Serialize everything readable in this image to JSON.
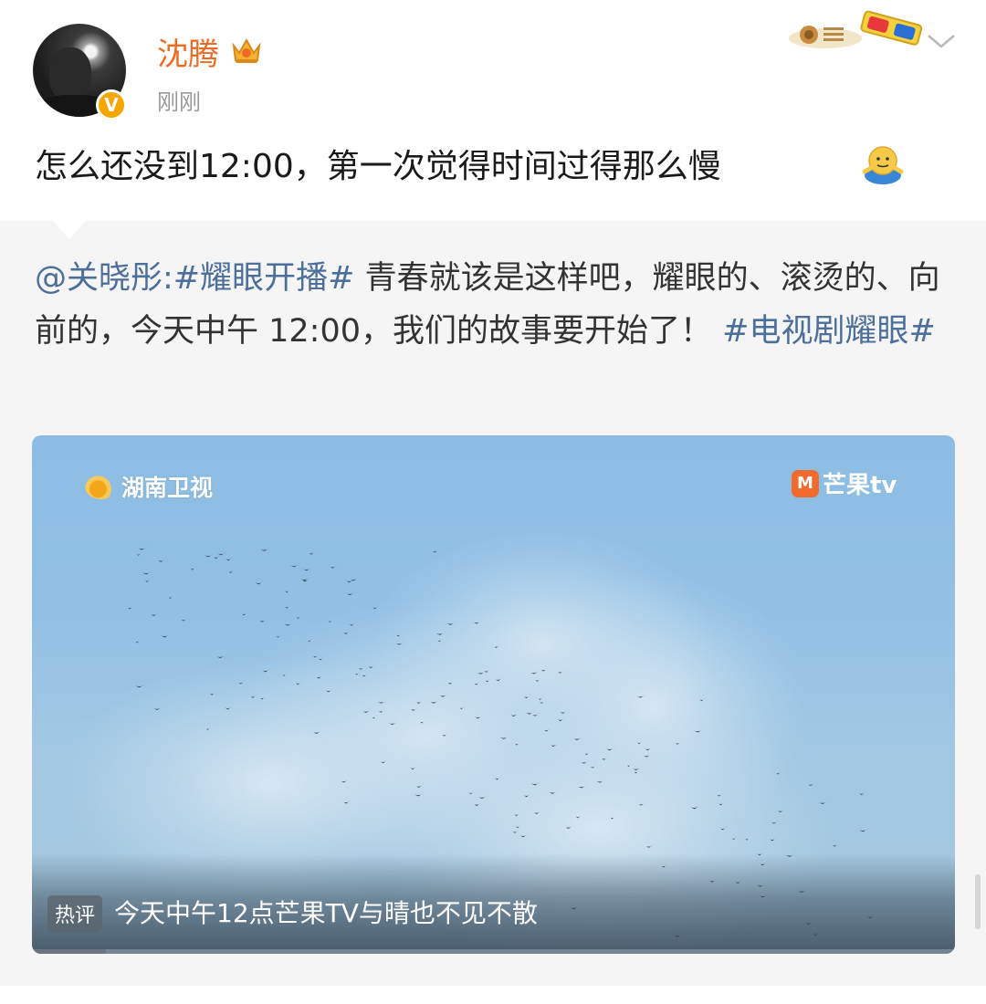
{
  "post": {
    "username": "沈腾",
    "timestamp": "刚刚",
    "content": "怎么还没到12:00，第一次觉得时间过得那么慢"
  },
  "repost": {
    "mention": "@关晓彤:",
    "topic1": "#耀眼开播#",
    "text": " 青春就该是这样吧，耀眼的、滚烫的、向前的，今天中午 12:00，我们的故事要开始了！",
    "topic2": "#电视剧耀眼#"
  },
  "media": {
    "broadcaster_logo": "湖南卫视",
    "platform_logo": "芒果tv",
    "hot_tag": "热评",
    "caption": "今天中午12点芒果TV与晴也不见不散",
    "progress": 0.08
  },
  "colors": {
    "username": "#f06a22",
    "link": "#4d6f9b",
    "verified_badge": "#f7a600"
  },
  "icons": [
    "crown-icon",
    "verified-icon",
    "chevron-down-icon",
    "smile-emoji-icon",
    "badge-deco-icon"
  ]
}
